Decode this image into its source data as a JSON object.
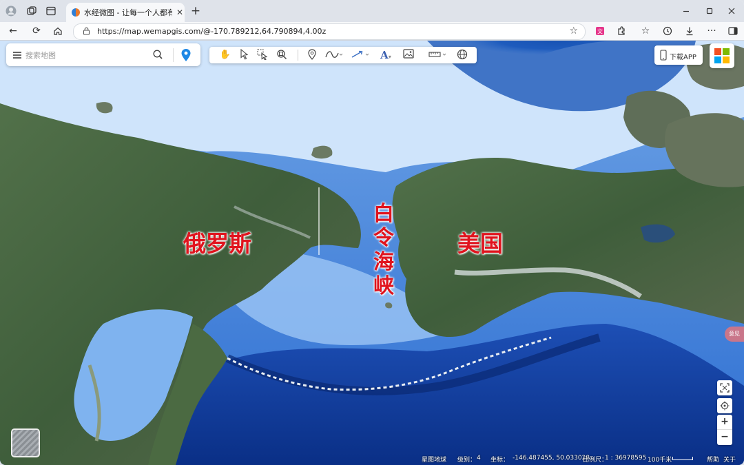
{
  "browser": {
    "tab_title": "水经微图 - 让每一个人都有自己的",
    "url": "https://map.wemapgis.com/@-170.789212,64.790894,4.00z"
  },
  "search": {
    "placeholder": "搜索地图"
  },
  "download_app": "下载APP",
  "map_labels": {
    "russia": "俄罗斯",
    "strait_chars": [
      "白",
      "令",
      "海",
      "峡"
    ],
    "usa": "美国"
  },
  "side_tab": "意见",
  "zoom": {
    "in": "+",
    "out": "−"
  },
  "statusbar": {
    "product": "星图地球",
    "level_label": "级别：",
    "level": "4",
    "coord_label": "坐标：",
    "coords": "-146.487455, 50.033028",
    "scale_label": "比例尺：",
    "scale": "1 : 36978595",
    "scale_bar": "100千米",
    "help": "帮助",
    "about": "关于"
  },
  "colors": {
    "label_red": "#e0141e",
    "marker_blue": "#1e88e5",
    "deep_ocean": "#0b3f9e",
    "ice": "#cfe4fb"
  },
  "icons": [
    "account-icon",
    "collections-icon",
    "tab-actions-icon",
    "new-tab-icon",
    "minimize-icon",
    "maximize-icon",
    "close-window-icon",
    "back-icon",
    "refresh-icon",
    "home-icon",
    "lock-icon",
    "favorite-icon",
    "translate-icon",
    "extensions-icon",
    "favorites-icon",
    "history-icon",
    "downloads-icon",
    "more-icon",
    "sidebar-icon",
    "pan-icon",
    "select-icon",
    "box-select-icon",
    "zoom-search-icon",
    "marker-icon",
    "line-icon",
    "arrow-icon",
    "text-icon",
    "image-icon",
    "measure-icon",
    "globe-icon",
    "phone-icon",
    "app-grid-icon",
    "screenshot-icon",
    "locate-icon"
  ]
}
